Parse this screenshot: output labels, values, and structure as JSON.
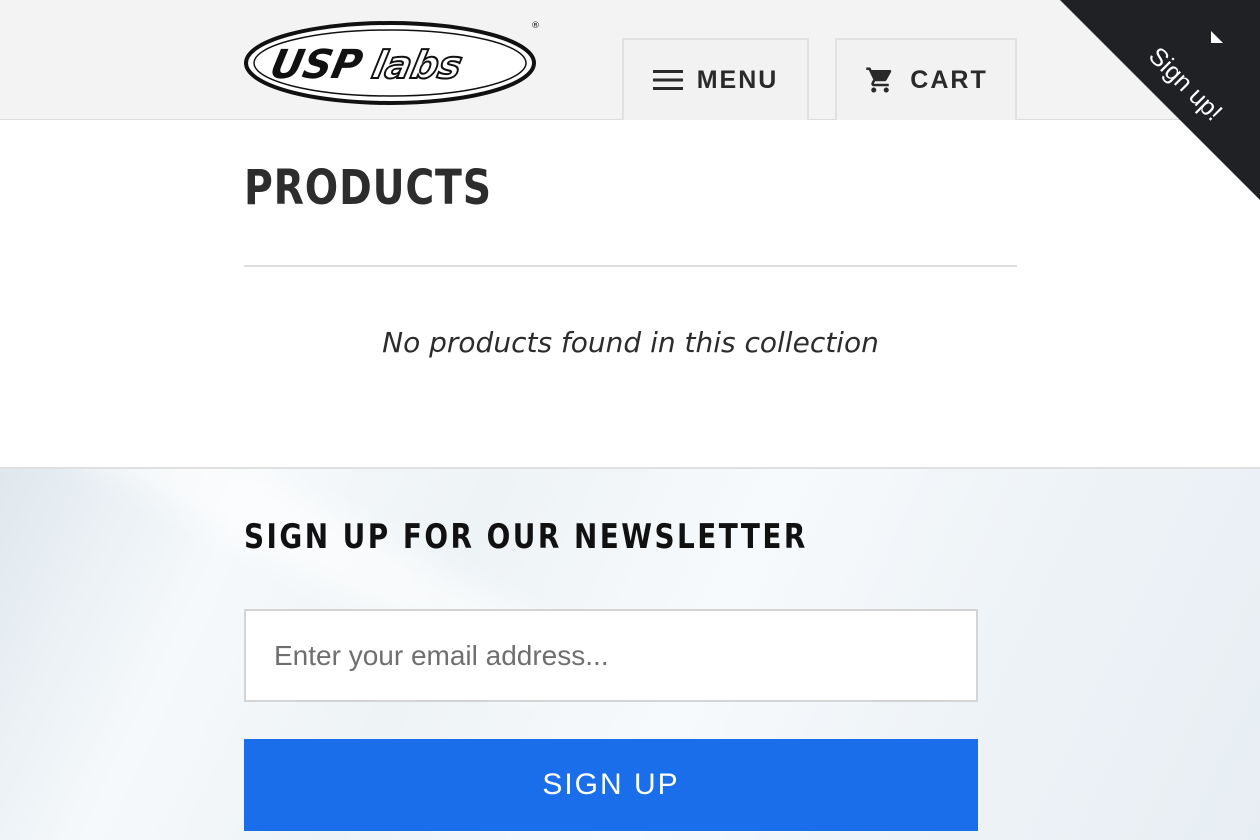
{
  "brand": {
    "logo_text": "USPlabs",
    "registered_mark": "®"
  },
  "header": {
    "menu_label": "MENU",
    "cart_label": "CART"
  },
  "signup_corner": {
    "label": "Sign up!"
  },
  "main": {
    "title": "PRODUCTS",
    "empty_message": "No products found in this collection"
  },
  "newsletter": {
    "title": "SIGN UP FOR OUR NEWSLETTER",
    "email_placeholder": "Enter your email address...",
    "email_value": "",
    "button_label": "SIGN UP"
  },
  "colors": {
    "accent": "#1a6eea",
    "corner_bg": "#1f2125",
    "header_bg": "#f3f3f3"
  },
  "icons": {
    "menu": "hamburger-icon",
    "cart": "cart-icon",
    "corner": "triangle-icon"
  }
}
